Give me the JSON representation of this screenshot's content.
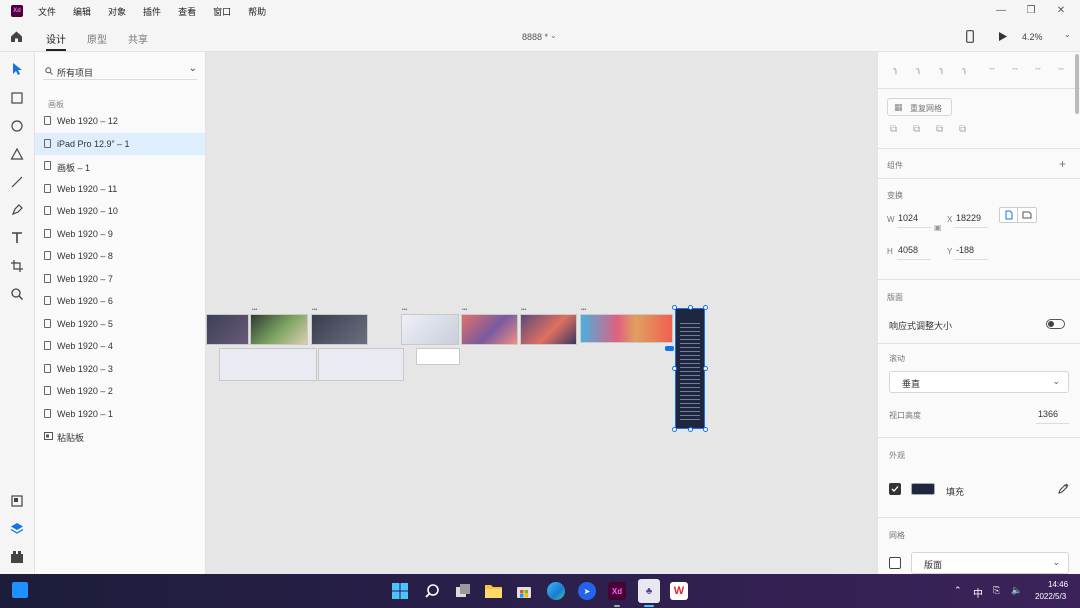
{
  "app": {
    "logo": "Xd"
  },
  "menu": [
    "文件",
    "编辑",
    "对象",
    "插件",
    "查看",
    "窗口",
    "帮助"
  ],
  "tabs": [
    {
      "label": "设计",
      "active": true
    },
    {
      "label": "原型",
      "active": false
    },
    {
      "label": "共享",
      "active": false
    }
  ],
  "document": {
    "title": "8888 *"
  },
  "zoom": "4.2%",
  "layers": {
    "search_label": "所有项目",
    "section_title": "画板",
    "items": [
      {
        "label": "Web 1920 – 12",
        "selected": false
      },
      {
        "label": "iPad Pro 12.9” – 1",
        "selected": true
      },
      {
        "label": "画板 – 1",
        "selected": false
      },
      {
        "label": "Web 1920 – 11",
        "selected": false
      },
      {
        "label": "Web 1920 – 10",
        "selected": false
      },
      {
        "label": "Web 1920 – 9",
        "selected": false
      },
      {
        "label": "Web 1920 – 8",
        "selected": false
      },
      {
        "label": "Web 1920 – 7",
        "selected": false
      },
      {
        "label": "Web 1920 – 6",
        "selected": false
      },
      {
        "label": "Web 1920 – 5",
        "selected": false
      },
      {
        "label": "Web 1920 – 4",
        "selected": false
      },
      {
        "label": "Web 1920 – 3",
        "selected": false
      },
      {
        "label": "Web 1920 – 2",
        "selected": false
      },
      {
        "label": "Web 1920 – 1",
        "selected": false
      }
    ],
    "pasteboard_label": "粘贴板"
  },
  "properties": {
    "repeat_grid": "重复网格",
    "components": "组件",
    "transform": "变换",
    "w_label": "W",
    "w": "1024",
    "x_label": "X",
    "x": "18229",
    "h_label": "H",
    "h": "4058",
    "y_label": "Y",
    "y": "-188",
    "layout": "版面",
    "responsive_resize": "响应式调整大小",
    "responsive_on": false,
    "scroll": "滚动",
    "scroll_value": "垂直",
    "viewport_height_label": "视口高度",
    "viewport_height": "1366",
    "appearance": "外观",
    "fill_label": "填充",
    "fill_color": "#1f2640",
    "fill_checked": true,
    "grid": "网格",
    "grid_value": "版面",
    "grid_checked": false
  },
  "taskbar": {
    "time": "14:46",
    "date": "2022/5/3",
    "ime": "中",
    "apps": [
      "windows-start",
      "search",
      "task-view",
      "file-explorer",
      "store",
      "edge",
      "feishu",
      "adobe-xd",
      "app-white",
      "wps"
    ]
  },
  "colors": {
    "accent": "#1473e6",
    "selection_bg": "#dfeefc",
    "canvas_bg": "#e6e6e6",
    "selected_board": "#1f2640"
  }
}
